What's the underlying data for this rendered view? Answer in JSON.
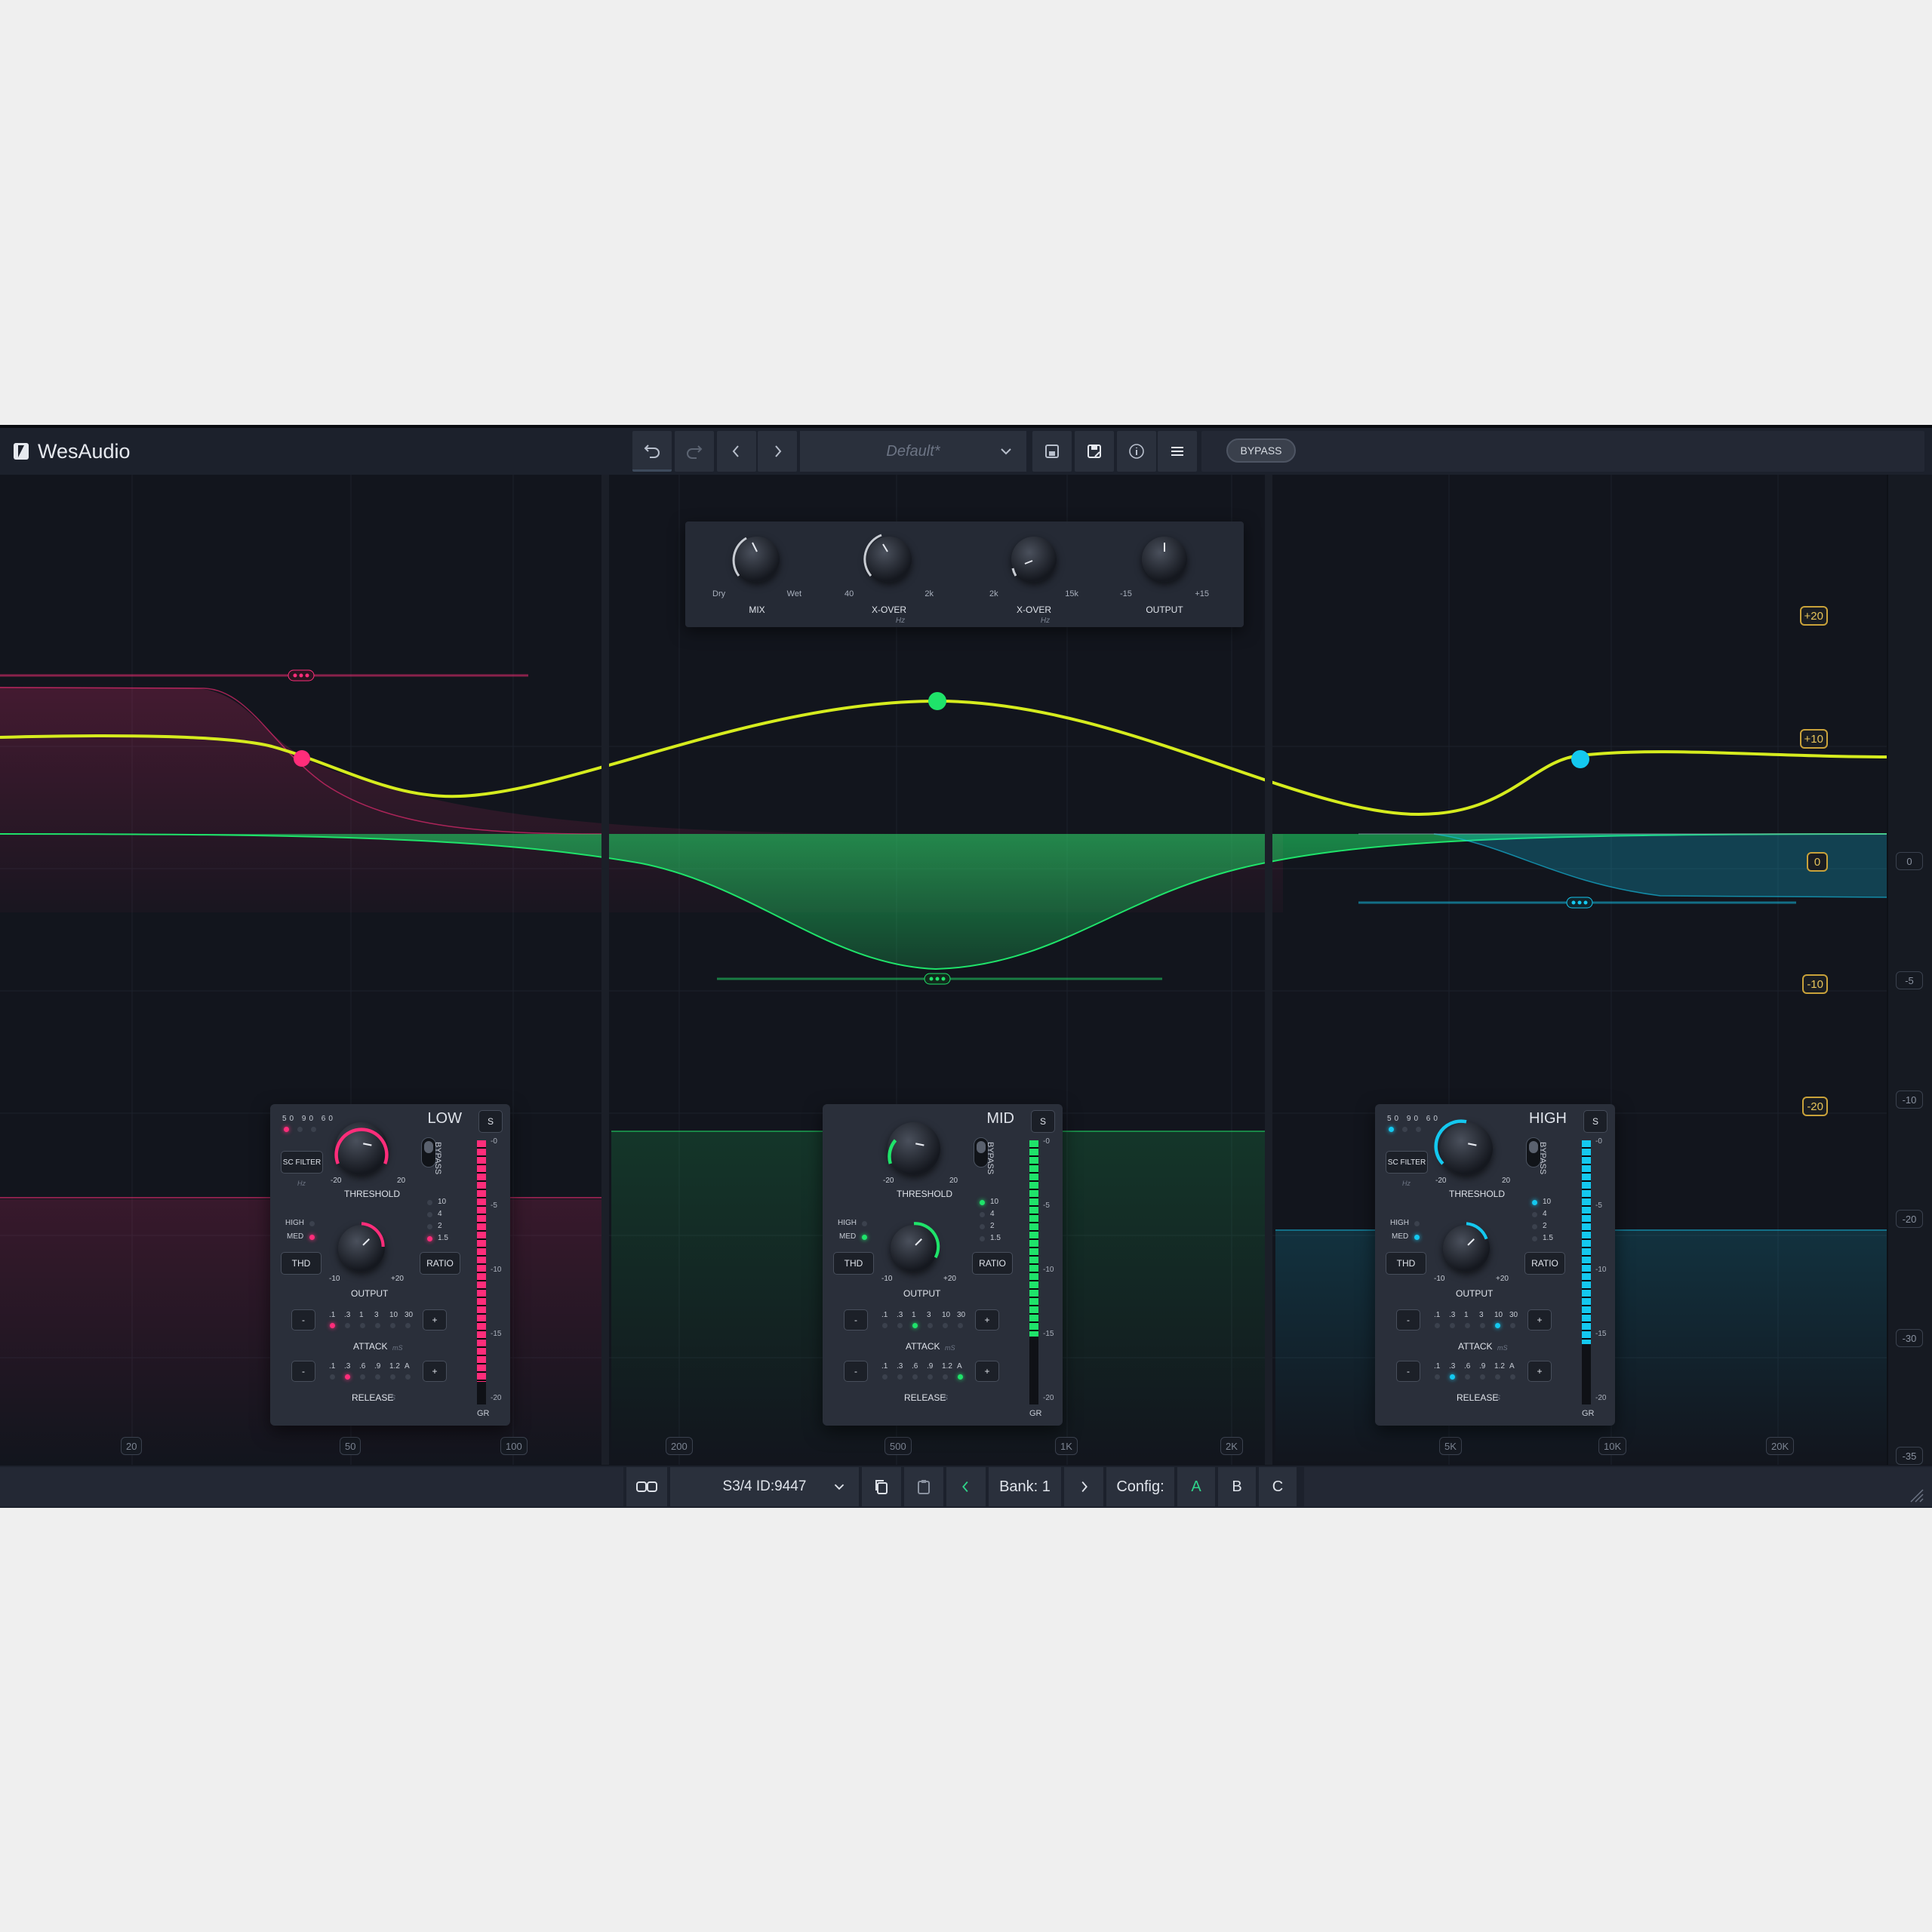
{
  "app": {
    "brand": "WesAudio"
  },
  "toolbar": {
    "preset": "Default*",
    "bypass": "BYPASS"
  },
  "global": [
    {
      "name": "MIX",
      "min": "Dry",
      "max": "Wet",
      "unit": ""
    },
    {
      "name": "X-OVER",
      "min": "40",
      "max": "2k",
      "unit": "Hz"
    },
    {
      "name": "X-OVER",
      "min": "2k",
      "max": "15k",
      "unit": "Hz"
    },
    {
      "name": "OUTPUT",
      "min": "-15",
      "max": "+15",
      "unit": ""
    }
  ],
  "gain_labels": [
    "+20",
    "+10",
    "0",
    "-10",
    "-20"
  ],
  "db_scale": [
    "0",
    "-5",
    "-10",
    "-20",
    "-30",
    "-35"
  ],
  "freq_labels": [
    "20",
    "50",
    "100",
    "200",
    "500",
    "1K",
    "2K",
    "5K",
    "10K",
    "20K"
  ],
  "bands": [
    {
      "name": "LOW",
      "color": "#ff2d7a"
    },
    {
      "name": "MID",
      "color": "#1fe36a"
    },
    {
      "name": "HIGH",
      "color": "#14c8ef"
    }
  ],
  "band_text": {
    "solo": "S",
    "scleds": "50 90 60",
    "scfilter": "SC FILTER",
    "hz": "Hz",
    "bypass": "BYPASS",
    "threshold": "THRESHOLD",
    "thr_min": "-20",
    "thr_max": "20",
    "output": "OUTPUT",
    "out_min": "-10",
    "out_max": "+20",
    "high": "HIGH",
    "med": "MED",
    "thd": "THD",
    "ratio": "RATIO",
    "ratios": [
      "10",
      "4",
      "2",
      "1.5"
    ],
    "attack": "ATTACK",
    "attack_unit": "mS",
    "attack_vals": [
      ".1",
      ".3",
      "1",
      "3",
      "10",
      "30"
    ],
    "release": "RELEASE",
    "release_unit": "S",
    "release_vals": [
      ".1",
      ".3",
      ".6",
      ".9",
      "1.2",
      "A"
    ],
    "minus": "-",
    "plus": "+",
    "gr": "GR",
    "meter_scale": [
      "-0",
      "-5",
      "-10",
      "-15",
      "-20"
    ]
  },
  "bottom": {
    "sc": "S3/4 ID:9447",
    "bank": "Bank: 1",
    "config": "Config:",
    "a": "A",
    "b": "B",
    "c": "C"
  }
}
